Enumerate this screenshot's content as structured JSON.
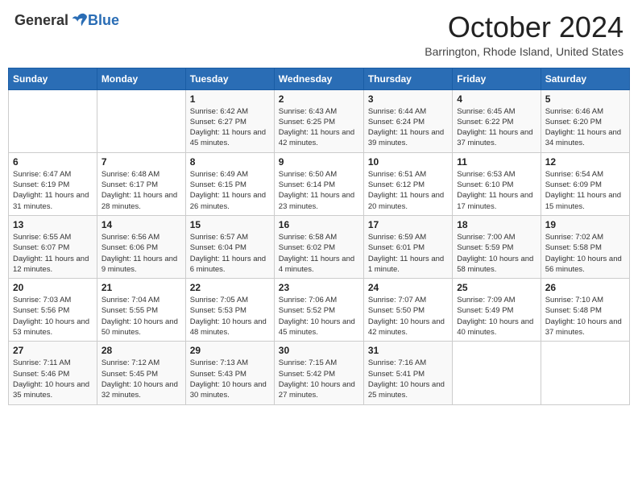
{
  "header": {
    "logo_general": "General",
    "logo_blue": "Blue",
    "month_title": "October 2024",
    "location": "Barrington, Rhode Island, United States"
  },
  "days_of_week": [
    "Sunday",
    "Monday",
    "Tuesday",
    "Wednesday",
    "Thursday",
    "Friday",
    "Saturday"
  ],
  "weeks": [
    [
      {
        "day": "",
        "info": ""
      },
      {
        "day": "",
        "info": ""
      },
      {
        "day": "1",
        "info": "Sunrise: 6:42 AM\nSunset: 6:27 PM\nDaylight: 11 hours and 45 minutes."
      },
      {
        "day": "2",
        "info": "Sunrise: 6:43 AM\nSunset: 6:25 PM\nDaylight: 11 hours and 42 minutes."
      },
      {
        "day": "3",
        "info": "Sunrise: 6:44 AM\nSunset: 6:24 PM\nDaylight: 11 hours and 39 minutes."
      },
      {
        "day": "4",
        "info": "Sunrise: 6:45 AM\nSunset: 6:22 PM\nDaylight: 11 hours and 37 minutes."
      },
      {
        "day": "5",
        "info": "Sunrise: 6:46 AM\nSunset: 6:20 PM\nDaylight: 11 hours and 34 minutes."
      }
    ],
    [
      {
        "day": "6",
        "info": "Sunrise: 6:47 AM\nSunset: 6:19 PM\nDaylight: 11 hours and 31 minutes."
      },
      {
        "day": "7",
        "info": "Sunrise: 6:48 AM\nSunset: 6:17 PM\nDaylight: 11 hours and 28 minutes."
      },
      {
        "day": "8",
        "info": "Sunrise: 6:49 AM\nSunset: 6:15 PM\nDaylight: 11 hours and 26 minutes."
      },
      {
        "day": "9",
        "info": "Sunrise: 6:50 AM\nSunset: 6:14 PM\nDaylight: 11 hours and 23 minutes."
      },
      {
        "day": "10",
        "info": "Sunrise: 6:51 AM\nSunset: 6:12 PM\nDaylight: 11 hours and 20 minutes."
      },
      {
        "day": "11",
        "info": "Sunrise: 6:53 AM\nSunset: 6:10 PM\nDaylight: 11 hours and 17 minutes."
      },
      {
        "day": "12",
        "info": "Sunrise: 6:54 AM\nSunset: 6:09 PM\nDaylight: 11 hours and 15 minutes."
      }
    ],
    [
      {
        "day": "13",
        "info": "Sunrise: 6:55 AM\nSunset: 6:07 PM\nDaylight: 11 hours and 12 minutes."
      },
      {
        "day": "14",
        "info": "Sunrise: 6:56 AM\nSunset: 6:06 PM\nDaylight: 11 hours and 9 minutes."
      },
      {
        "day": "15",
        "info": "Sunrise: 6:57 AM\nSunset: 6:04 PM\nDaylight: 11 hours and 6 minutes."
      },
      {
        "day": "16",
        "info": "Sunrise: 6:58 AM\nSunset: 6:02 PM\nDaylight: 11 hours and 4 minutes."
      },
      {
        "day": "17",
        "info": "Sunrise: 6:59 AM\nSunset: 6:01 PM\nDaylight: 11 hours and 1 minute."
      },
      {
        "day": "18",
        "info": "Sunrise: 7:00 AM\nSunset: 5:59 PM\nDaylight: 10 hours and 58 minutes."
      },
      {
        "day": "19",
        "info": "Sunrise: 7:02 AM\nSunset: 5:58 PM\nDaylight: 10 hours and 56 minutes."
      }
    ],
    [
      {
        "day": "20",
        "info": "Sunrise: 7:03 AM\nSunset: 5:56 PM\nDaylight: 10 hours and 53 minutes."
      },
      {
        "day": "21",
        "info": "Sunrise: 7:04 AM\nSunset: 5:55 PM\nDaylight: 10 hours and 50 minutes."
      },
      {
        "day": "22",
        "info": "Sunrise: 7:05 AM\nSunset: 5:53 PM\nDaylight: 10 hours and 48 minutes."
      },
      {
        "day": "23",
        "info": "Sunrise: 7:06 AM\nSunset: 5:52 PM\nDaylight: 10 hours and 45 minutes."
      },
      {
        "day": "24",
        "info": "Sunrise: 7:07 AM\nSunset: 5:50 PM\nDaylight: 10 hours and 42 minutes."
      },
      {
        "day": "25",
        "info": "Sunrise: 7:09 AM\nSunset: 5:49 PM\nDaylight: 10 hours and 40 minutes."
      },
      {
        "day": "26",
        "info": "Sunrise: 7:10 AM\nSunset: 5:48 PM\nDaylight: 10 hours and 37 minutes."
      }
    ],
    [
      {
        "day": "27",
        "info": "Sunrise: 7:11 AM\nSunset: 5:46 PM\nDaylight: 10 hours and 35 minutes."
      },
      {
        "day": "28",
        "info": "Sunrise: 7:12 AM\nSunset: 5:45 PM\nDaylight: 10 hours and 32 minutes."
      },
      {
        "day": "29",
        "info": "Sunrise: 7:13 AM\nSunset: 5:43 PM\nDaylight: 10 hours and 30 minutes."
      },
      {
        "day": "30",
        "info": "Sunrise: 7:15 AM\nSunset: 5:42 PM\nDaylight: 10 hours and 27 minutes."
      },
      {
        "day": "31",
        "info": "Sunrise: 7:16 AM\nSunset: 5:41 PM\nDaylight: 10 hours and 25 minutes."
      },
      {
        "day": "",
        "info": ""
      },
      {
        "day": "",
        "info": ""
      }
    ]
  ]
}
